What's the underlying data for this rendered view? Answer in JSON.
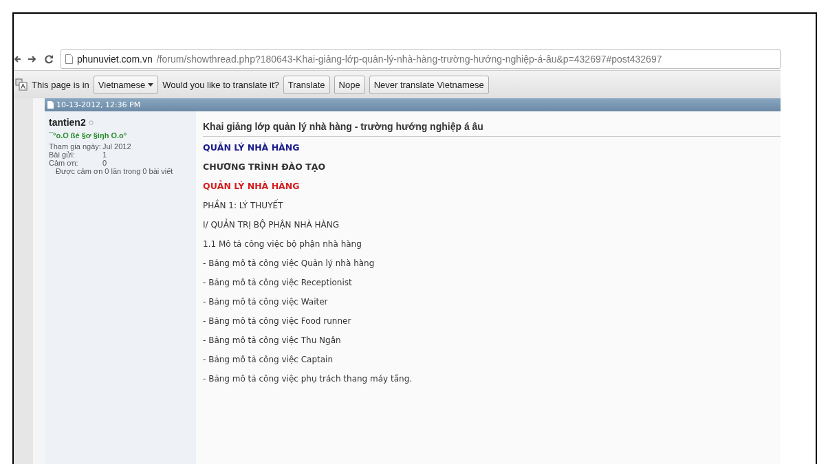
{
  "browser": {
    "url_host": "phunuviet.com.vn",
    "url_path": "/forum/showthread.php?180643-Khai-giảng-lớp-quản-lý-nhà-hàng-trường-hướng-nghiệp-á-âu&p=432697#post432697"
  },
  "translate_bar": {
    "lead": "This page is in",
    "language": "Vietnamese",
    "question": "Would you like to translate it?",
    "buttons": [
      "Translate",
      "Nope",
      "Never translate Vietnamese"
    ]
  },
  "post": {
    "date": "10-13-2012, 12:36 PM",
    "user": {
      "name": "tantien2",
      "title": "¯°o.O ßé §ơ §iŋh O.o°",
      "stats": [
        {
          "label": "Tham gia ngày:",
          "value": "Jul 2012"
        },
        {
          "label": "Bài gửi:",
          "value": "1"
        },
        {
          "label": "Cảm ơn:",
          "value": "0"
        }
      ],
      "thanked": "Được cảm ơn 0 lần trong 0 bài viết"
    },
    "title": "Khai giảng lớp quản lý nhà hàng - trường hướng nghiệp á âu",
    "lines": [
      {
        "kind": "heading",
        "color": "#1a1a8c",
        "text": "QUẢN LÝ NHÀ HÀNG"
      },
      {
        "kind": "heading",
        "color": "#333333",
        "text": "CHƯƠNG TRÌNH ĐÀO TẠO"
      },
      {
        "kind": "heading",
        "color": "#d42020",
        "text": "QUẢN LÝ NHÀ HÀNG"
      },
      {
        "kind": "text",
        "text": "PHẦN 1: LÝ THUYẾT"
      },
      {
        "kind": "text",
        "text": "I/ QUẢN TRỊ BỘ PHẬN NHÀ HÀNG"
      },
      {
        "kind": "text",
        "text": "1.1 Mô tả công việc bộ phận nhà hàng"
      },
      {
        "kind": "text",
        "text": "- Bảng mô tả công việc Quản lý nhà hàng"
      },
      {
        "kind": "text",
        "text": "- Bảng mô tả công việc Receptionist"
      },
      {
        "kind": "text",
        "text": "- Bảng mô tả công việc Waiter"
      },
      {
        "kind": "text",
        "text": "- Bảng mô tả công việc Food runner"
      },
      {
        "kind": "text",
        "text": "- Bảng mô tả công việc Thu Ngân"
      },
      {
        "kind": "text",
        "text": "- Bảng mô tả công việc Captain"
      },
      {
        "kind": "text",
        "text": "- Bảng mô tả công việc phụ trách thang máy tầng."
      }
    ]
  }
}
